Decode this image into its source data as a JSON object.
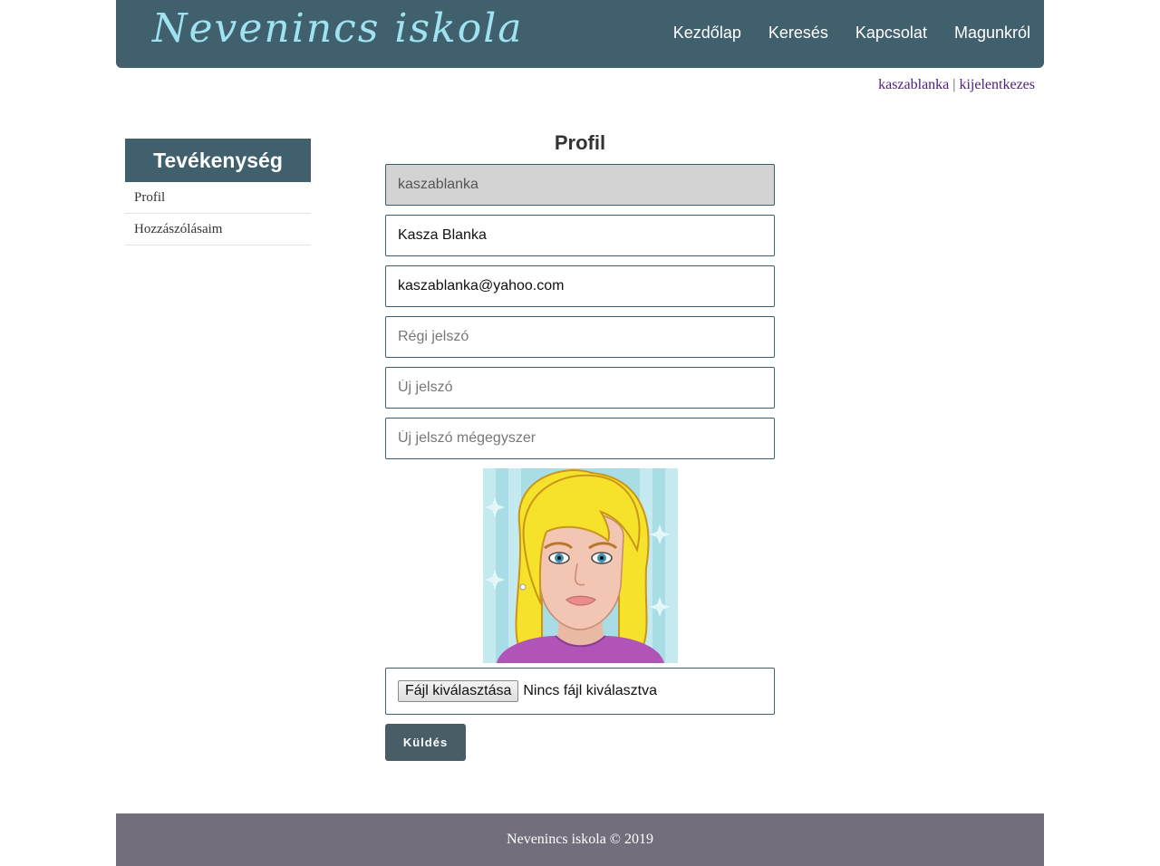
{
  "header": {
    "logo": "Nevenincs iskola",
    "nav": [
      "Kezdőlap",
      "Keresés",
      "Kapcsolat",
      "Magunkról"
    ]
  },
  "userbar": {
    "username": "kaszablanka",
    "separator": "|",
    "logout": "kijelentkezes"
  },
  "sidebar": {
    "title": "Tevékenység",
    "items": [
      "Profil",
      "Hozzászólásaim"
    ]
  },
  "main": {
    "title": "Profil",
    "username_value": "kaszablanka",
    "fullname_value": "Kasza Blanka",
    "email_value": "kaszablanka@yahoo.com",
    "old_password_placeholder": "Régi jelszó",
    "new_password_placeholder": "Új jelszó",
    "new_password_again_placeholder": "Új jelszó mégegyszer",
    "file_button": "Fájl kiválasztása",
    "file_status": "Nincs fájl kiválasztva",
    "submit": "Küldés"
  },
  "footer": {
    "text": "Nevenincs iskola © 2019"
  },
  "colors": {
    "header_bg": "#40606e",
    "logo": "#9fe3f0",
    "footer_bg": "#726e7b",
    "button_bg": "#485d66",
    "link": "#4b1f7a"
  },
  "icons": {
    "avatar": "blonde-girl-avatar"
  }
}
